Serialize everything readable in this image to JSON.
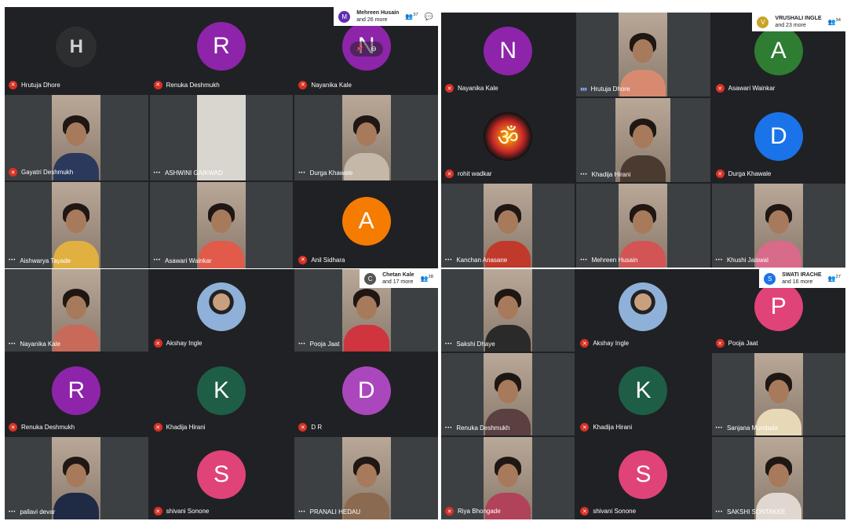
{
  "colors": {
    "panel_bg": "#202124",
    "tile_bg": "#3c4043",
    "mic_off": "#d93025",
    "header_bg": "#ffffff"
  },
  "panels": [
    {
      "header": {
        "avatar_letter": "M",
        "avatar_color": "#5f2eb3",
        "line1": "Mehreen Husain",
        "line2": "and 26 more",
        "count": "37",
        "show_chat": true
      },
      "tiles": [
        {
          "name": "Hrutuja Dhore",
          "status": "muted",
          "type": "logo",
          "letter": "H"
        },
        {
          "name": "Renuka Deshmukh",
          "status": "muted",
          "type": "avatar",
          "letter": "R",
          "color": "#8e24aa"
        },
        {
          "name": "Nayanika Kale",
          "status": "muted",
          "type": "avatar",
          "letter": "N",
          "color": "#8e24aa",
          "hover": true
        },
        {
          "name": "Gayatri Deshmukh",
          "status": "muted",
          "type": "video",
          "shirt": "#2b3a5c"
        },
        {
          "name": "ASHWINI GAIKWAD",
          "status": "dots",
          "type": "video",
          "shirt": "#d8d2c8",
          "empty": true
        },
        {
          "name": "Durga Khawale",
          "status": "dots",
          "type": "video",
          "shirt": "#c5b8a8"
        },
        {
          "name": "Aishwarya Tayade",
          "status": "dots",
          "type": "video",
          "shirt": "#e0b040"
        },
        {
          "name": "Asawari Wainkar",
          "status": "dots",
          "type": "video",
          "shirt": "#e25a4a"
        },
        {
          "name": "Anil Sidhara",
          "status": "muted",
          "type": "avatar",
          "letter": "A",
          "color": "#f57c00"
        }
      ]
    },
    {
      "header": {
        "avatar_letter": "V",
        "avatar_color": "#c9a227",
        "line1": "VRUSHALI INGLE",
        "line2": "and 23 more",
        "count": "34",
        "show_chat": false
      },
      "tiles": [
        {
          "name": "Nayanika Kale",
          "status": "muted",
          "type": "avatar",
          "letter": "N",
          "color": "#8e24aa"
        },
        {
          "name": "Hrutuja Dhore",
          "status": "speaking",
          "type": "video",
          "shirt": "#d88a70"
        },
        {
          "name": "Asawari Wainkar",
          "status": "muted",
          "type": "avatar",
          "letter": "A",
          "color": "#2e7d32"
        },
        {
          "name": "rohit wadkar",
          "status": "muted",
          "type": "logo2",
          "letter": "ॐ"
        },
        {
          "name": "Khadija Hirani",
          "status": "dots",
          "type": "video",
          "shirt": "#4a3a30",
          "wide": true
        },
        {
          "name": "Durga Khawale",
          "status": "muted",
          "type": "avatar",
          "letter": "D",
          "color": "#1a73e8"
        },
        {
          "name": "Kanchan Anasane",
          "status": "dots",
          "type": "video",
          "shirt": "#c0392b"
        },
        {
          "name": "Mehreen Husain",
          "status": "dots",
          "type": "video",
          "shirt": "#d35454"
        },
        {
          "name": "Khushi Jaiswal",
          "status": "dots",
          "type": "video",
          "shirt": "#d86a8a"
        }
      ]
    },
    {
      "header": {
        "avatar_letter": "C",
        "avatar_color": "#555555",
        "line1": "Chetan Kale",
        "line2": "and 17 more",
        "count": "28",
        "show_chat": false
      },
      "tiles": [
        {
          "name": "Nayanika Kale",
          "status": "dots",
          "type": "video",
          "shirt": "#c86a5a"
        },
        {
          "name": "Akshay Ingle",
          "status": "muted",
          "type": "photo",
          "shirt": "#3b4a6b"
        },
        {
          "name": "Pooja Jaat",
          "status": "dots",
          "type": "video",
          "shirt": "#d0343e"
        },
        {
          "name": "Renuka Deshmukh",
          "status": "muted",
          "type": "avatar",
          "letter": "R",
          "color": "#8e24aa"
        },
        {
          "name": "Khadija Hirani",
          "status": "muted",
          "type": "avatar",
          "letter": "K",
          "color": "#1e5e46"
        },
        {
          "name": "D R",
          "status": "muted",
          "type": "avatar",
          "letter": "D",
          "color": "#ab47bc"
        },
        {
          "name": "pallavi devar",
          "status": "dots",
          "type": "video",
          "shirt": "#1f2a44"
        },
        {
          "name": "shivani Sonone",
          "status": "muted",
          "type": "avatar",
          "letter": "S",
          "color": "#e04378"
        },
        {
          "name": "PRANALI HEDAU",
          "status": "dots",
          "type": "video",
          "shirt": "#8a6a50"
        }
      ]
    },
    {
      "header": {
        "avatar_letter": "S",
        "avatar_color": "#1a73e8",
        "line1": "SWATI IRACHE",
        "line2": "and 16 more",
        "count": "27",
        "show_chat": false
      },
      "tiles": [
        {
          "name": "Sakshi Dhaye",
          "status": "dots",
          "type": "video",
          "shirt": "#2a2a2a"
        },
        {
          "name": "Akshay Ingle",
          "status": "muted",
          "type": "photo",
          "shirt": "#3b4a6b"
        },
        {
          "name": "Pooja Jaat",
          "status": "muted",
          "type": "avatar",
          "letter": "P",
          "color": "#e04378"
        },
        {
          "name": "Renuka Deshmukh",
          "status": "dots",
          "type": "video",
          "shirt": "#5a4040"
        },
        {
          "name": "Khadija Hirani",
          "status": "muted",
          "type": "avatar",
          "letter": "K",
          "color": "#1e5e46"
        },
        {
          "name": "Sanjana Mundada",
          "status": "dots",
          "type": "video",
          "shirt": "#e7d8b8"
        },
        {
          "name": "Riya Bhongade",
          "status": "muted",
          "type": "video",
          "shirt": "#b0425a"
        },
        {
          "name": "shivani Sonone",
          "status": "muted",
          "type": "avatar",
          "letter": "S",
          "color": "#e04378"
        },
        {
          "name": "SAKSHI SONTAKKE",
          "status": "dots",
          "type": "video",
          "shirt": "#e0d8d0"
        }
      ]
    }
  ]
}
